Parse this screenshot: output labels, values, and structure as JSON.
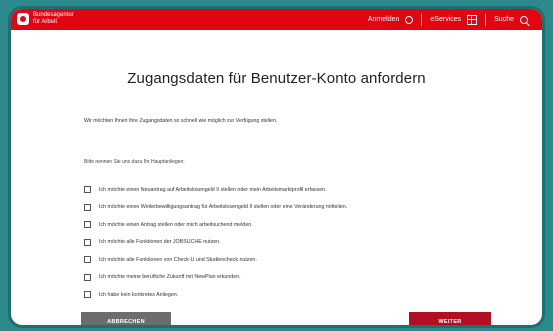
{
  "header": {
    "logo_line1": "Bundesagentur",
    "logo_line2": "für Arbeit",
    "nav": [
      {
        "label": "Anmelden",
        "icon": "user-icon"
      },
      {
        "label": "eServices",
        "icon": "grid-icon"
      },
      {
        "label": "Suche",
        "icon": "search-icon"
      }
    ],
    "brand_color": "#e20613"
  },
  "main": {
    "title": "Zugangsdaten für Benutzer-Konto anfordern",
    "intro": "Wir möchten Ihnen Ihre Zugangsdaten so schnell wie möglich zur Verfügung stellen.",
    "question": "Bitte nennen Sie uns dazu Ihr Hauptanliegen:",
    "options": [
      "Ich möchte einen Neuantrag auf Arbeitslosengeld II stellen oder mein Arbeitsmarktprofil erfassen.",
      "Ich möchte einen Weiterbewilligungsantrag für Arbeitslosengeld II stellen oder eine Veränderung mitteilen.",
      "Ich möchte einen Antrag stellen oder mich arbeitsuchend melden.",
      "Ich möchte alle Funktionen der JOBSUCHE nutzen.",
      "Ich möchte alle Funktionen von Check-U und Studiencheck nutzen.",
      "Ich möchte meine berufliche Zukunft mit NewPlan erkunden.",
      "Ich habe kein konkretes Anliegen."
    ]
  },
  "buttons": {
    "cancel": "ABBRECHEN",
    "next": "WEITER"
  }
}
